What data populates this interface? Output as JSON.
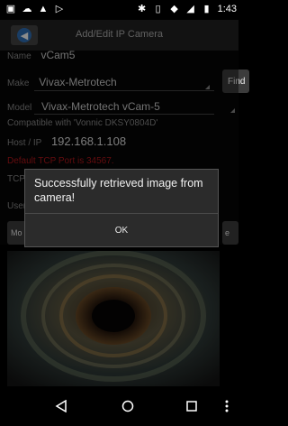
{
  "status_bar": {
    "time": "1:43",
    "icons_left": [
      "gallery-icon",
      "cloud-icon",
      "alert-icon",
      "play-store-icon"
    ],
    "icons_right": [
      "bluetooth-icon",
      "vibrate-icon",
      "wifi-icon",
      "signal-icon",
      "battery-icon"
    ]
  },
  "appbar": {
    "title": "Add/Edit IP Camera"
  },
  "form": {
    "name_label": "Name",
    "name_value": "vCam5",
    "make_label": "Make",
    "make_value": "Vivax-Metrotech",
    "find_label": "Find",
    "model_label": "Model",
    "model_value": "Vivax-Metrotech vCam-5",
    "compat_text": "Compatible with 'Vonnic DKSY0804D'",
    "host_label": "Host / IP",
    "host_value": "192.168.1.108",
    "default_port_text": "Default TCP Port is 34567.",
    "tcp_label": "TCP",
    "user_label": "User",
    "mo_label": "Mo",
    "e_label": "e"
  },
  "dialog": {
    "message": "Successfully retrieved image from camera!",
    "ok_label": "OK"
  },
  "navbar": {
    "items": [
      "back-icon",
      "home-icon",
      "recents-icon",
      "more-icon"
    ]
  },
  "colors": {
    "accent_blue": "#2f6fb8",
    "error_red": "#b4161b",
    "dialog_bg": "#2b2b2b"
  }
}
